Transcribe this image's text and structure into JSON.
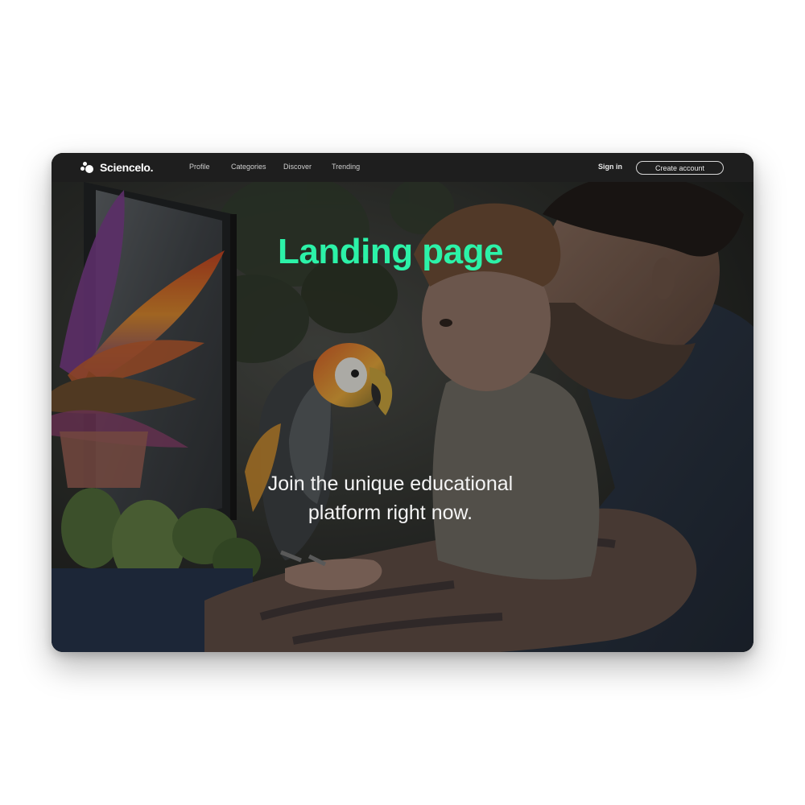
{
  "brand": {
    "name": "Sciencelo."
  },
  "nav": {
    "links": [
      "Profile",
      "Categories",
      "Discover",
      "Trending"
    ],
    "sign_in": "Sign in",
    "create_account": "Create account"
  },
  "hero": {
    "title": "Landing page",
    "subtitle": "Join the unique educational platform right now."
  },
  "colors": {
    "accent": "#2cf2a8",
    "navbar_bg": "#1e1e1e"
  },
  "hero_image": {
    "description_icons": [
      "parrot",
      "child",
      "man-with-beard",
      "computer-monitor",
      "cactus",
      "tropical-plant"
    ]
  }
}
